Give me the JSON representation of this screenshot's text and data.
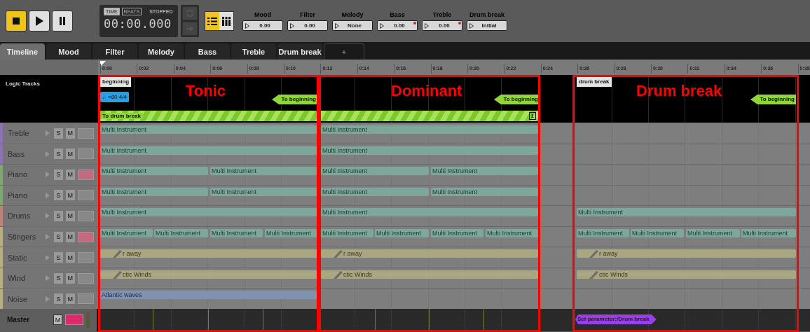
{
  "transport": [
    {
      "kind": "stop",
      "on": true
    },
    {
      "kind": "play",
      "on": false
    },
    {
      "kind": "pause",
      "on": false
    }
  ],
  "time_display": {
    "modes": [
      {
        "label": "TIME",
        "selected": true
      },
      {
        "label": "BEATS",
        "selected": false
      }
    ],
    "status": "STOPPED",
    "time": "00:00.000"
  },
  "view_buttons": [
    {
      "kind": "list",
      "selected": true
    },
    {
      "kind": "grid",
      "selected": false
    }
  ],
  "parameters": [
    {
      "name": "Mood",
      "value": "0.00",
      "automated": false
    },
    {
      "name": "Filter",
      "value": "0.00",
      "automated": false
    },
    {
      "name": "Melody",
      "value": "None",
      "automated": false
    },
    {
      "name": "Bass",
      "value": "0.00",
      "automated": true
    },
    {
      "name": "Treble",
      "value": "0.00",
      "automated": true
    },
    {
      "name": "Drum break",
      "value": "Initial",
      "automated": false
    }
  ],
  "tabs": [
    {
      "label": "Timeline",
      "selected": true
    },
    {
      "label": "Mood",
      "selected": false
    },
    {
      "label": "Filter",
      "selected": false
    },
    {
      "label": "Melody",
      "selected": false
    },
    {
      "label": "Bass",
      "selected": false
    },
    {
      "label": "Treble",
      "selected": false
    },
    {
      "label": "Drum break",
      "selected": false
    }
  ],
  "add_tab": "+",
  "ruler": [
    "0:00",
    "0:02",
    "0:04",
    "0:06",
    "0:08",
    "0:10",
    "0:12",
    "0:14",
    "0:16",
    "0:18",
    "0:20",
    "0:22",
    "0:24",
    "0:26",
    "0:28",
    "0:30",
    "0:32",
    "0:34",
    "0:36",
    "0:38"
  ],
  "logic_tracks": {
    "label": "Logic Tracks",
    "markers": [
      {
        "label": "beginning"
      },
      {
        "label": "drum break"
      }
    ],
    "tempo": "♩=80 4/4",
    "loops": [
      {
        "label": "To beginning"
      },
      {
        "label": "To beginning"
      },
      {
        "label": "To beginning"
      }
    ],
    "transition": {
      "label": "To drum break",
      "count": "1"
    }
  },
  "tracks": [
    {
      "name": "Treble",
      "color": "#8e72b8",
      "solo": "S",
      "mute": "M",
      "peak": false,
      "clips": [
        {
          "kind": "instrument",
          "label": "Multi Instrument"
        },
        {
          "kind": "instrument",
          "label": "Multi Instrument"
        }
      ]
    },
    {
      "name": "Bass",
      "color": "#8e72b8",
      "solo": "S",
      "mute": "M",
      "peak": false,
      "clips": [
        {
          "kind": "instrument",
          "label": "Multi Instrument"
        },
        {
          "kind": "instrument",
          "label": "Multi Instrument"
        }
      ]
    },
    {
      "name": "Piano",
      "color": "#7ea872",
      "solo": "S",
      "mute": "M",
      "peak": true,
      "clips": [
        {
          "kind": "instrument",
          "label": "Multi Instrument"
        },
        {
          "kind": "instrument",
          "label": "Multi Instrument"
        },
        {
          "kind": "instrument",
          "label": "Multi Instrument"
        },
        {
          "kind": "instrument",
          "label": "Multi Instrument"
        }
      ]
    },
    {
      "name": "Piano",
      "color": "#7ea872",
      "solo": "S",
      "mute": "M",
      "peak": false,
      "clips": [
        {
          "kind": "instrument",
          "label": "Multi Instrument"
        },
        {
          "kind": "instrument",
          "label": "Multi Instrument"
        },
        {
          "kind": "instrument",
          "label": "Multi Instrument"
        },
        {
          "kind": "instrument",
          "label": "Multi Instrument"
        }
      ]
    },
    {
      "name": "Drums",
      "color": "#c08276",
      "solo": "S",
      "mute": "M",
      "peak": false,
      "clips": [
        {
          "kind": "instrument",
          "label": "Multi Instrument"
        },
        {
          "kind": "instrument",
          "label": "Multi Instrument"
        },
        {
          "kind": "instrument",
          "label": "Multi Instrument"
        }
      ]
    },
    {
      "name": "Stingers",
      "color": "#b8b07a",
      "solo": "S",
      "mute": "M",
      "peak": true,
      "clips": [
        {
          "kind": "instrument",
          "label": "Multi Instrument"
        },
        {
          "kind": "instrument",
          "label": "Multi Instrument"
        },
        {
          "kind": "instrument",
          "label": "Multi Instrument"
        },
        {
          "kind": "instrument",
          "label": "Multi Instrument"
        },
        {
          "kind": "instrument",
          "label": "Multi Instrument"
        },
        {
          "kind": "instrument",
          "label": "Multi Instrument"
        },
        {
          "kind": "instrument",
          "label": "Multi Instrument"
        },
        {
          "kind": "instrument",
          "label": "Multi Instrument"
        },
        {
          "kind": "instrument",
          "label": "Multi Instrument"
        },
        {
          "kind": "instrument",
          "label": "Multi Instrument"
        },
        {
          "kind": "instrument",
          "label": "Multi Instrument"
        },
        {
          "kind": "instrument",
          "label": "Multi Instrument"
        }
      ]
    },
    {
      "name": "Static",
      "color": "#b8b07a",
      "solo": "S",
      "mute": "M",
      "peak": false,
      "clips": [
        {
          "kind": "loop",
          "label": "r away"
        },
        {
          "kind": "loop",
          "label": "r away"
        },
        {
          "kind": "loop",
          "label": "r away"
        }
      ]
    },
    {
      "name": "Wind",
      "color": "#b8b07a",
      "solo": "S",
      "mute": "M",
      "peak": false,
      "clips": [
        {
          "kind": "loop",
          "label": "ctic Winds"
        },
        {
          "kind": "loop",
          "label": "ctic Winds"
        },
        {
          "kind": "loop",
          "label": "ctic Winds"
        }
      ]
    },
    {
      "name": "Noise",
      "color": "#b8b07a",
      "solo": "S",
      "mute": "M",
      "peak": false,
      "clips": [
        {
          "kind": "audio",
          "label": "Atlantic waves"
        }
      ]
    }
  ],
  "master": {
    "name": "Master",
    "mute": "M",
    "peak": true,
    "event": "Set parameter:/Drum break"
  },
  "regions": [
    {
      "title": "Tonic"
    },
    {
      "title": "Dominant"
    },
    {
      "title": "Drum break"
    }
  ]
}
